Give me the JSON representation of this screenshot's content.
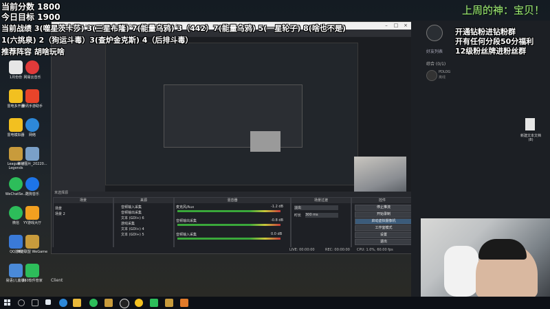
{
  "overlay": {
    "score": "当前分数 1800",
    "goal": "今日目标 1900",
    "record_line1": "当前战绩 3(噬星茨卡莎) 3(三星布隆) 7(能量乌鸦) 3（442）7(能量乌鸦) 5(一星轮子) 8(啥也不是)",
    "record_line2": "1(六挑泉) 2（狗运斗毒）3(查炉金克斯) 4（后排斗毒）",
    "lineup": "推荐阵容 胡啥玩啥",
    "god_text": "上周的神：宝贝！",
    "promo": [
      "开通钻粉进钻粉群",
      "开有任何分段50分福利",
      "12级粉丝牌进粉丝群"
    ]
  },
  "desktop": {
    "icons": [
      {
        "label": "1月份份",
        "color": "#e6e6e6"
      },
      {
        "label": "网易云音乐",
        "color": "#e03a3a"
      },
      {
        "label": "雷电多开器",
        "color": "#f2c020"
      },
      {
        "label": "腾讯手游助手",
        "color": "#e8442a"
      },
      {
        "label": "雷电模拟器",
        "color": "#f2c020"
      },
      {
        "label": "网络",
        "color": "#2d88d8"
      },
      {
        "label": "League of Legends",
        "color": "#c89b3c"
      },
      {
        "label": "微信图片_20220...",
        "color": "#7aa0c8"
      },
      {
        "label": "WeChatSe...",
        "color": "#2dbd5a"
      },
      {
        "label": "酷狗音乐",
        "color": "#1d74e8"
      },
      {
        "label": "微信",
        "color": "#2dbd5a"
      },
      {
        "label": "YY游戏大厅",
        "color": "#f2a020"
      },
      {
        "label": "QQ游戏",
        "color": "#3a7ad8"
      },
      {
        "label": "英雄联盟 WeGame",
        "color": "#c89b3c"
      },
      {
        "label": "易语(儿童版)",
        "color": "#4a8ad8"
      },
      {
        "label": "360软件管家",
        "color": "#2dbd5a"
      }
    ],
    "right_icon_label": "新建文本文档(8)",
    "client_label": "Client"
  },
  "right_panel": {
    "header": "好友列表",
    "group": "综合 (0/1)",
    "user_name": "PDLOG",
    "user_status": "离线"
  },
  "obs": {
    "title": "OBS 27.1.3 (64-bit, windows) - 配置文件: 未命名 - 场景: 未命名",
    "docks": {
      "scenes": {
        "title": "场景",
        "items": [
          "场景",
          "场景 2"
        ]
      },
      "sources": {
        "title": "来源",
        "items": [
          "音频输入采集",
          "音频输出采集",
          "文本 (GDI+) 6",
          "游戏采集",
          "文本 (GDI+) 4",
          "文本 (GDI+) 5"
        ]
      },
      "mixer": {
        "title": "混音器",
        "channels": [
          {
            "name": "音频输出采集",
            "db": "-0.8 dB"
          },
          {
            "name": "麦克风/Aux",
            "db": "-1.2 dB"
          },
          {
            "name": "音频输入采集",
            "db": "0.0 dB"
          }
        ]
      },
      "transitions": {
        "title": "场景过渡",
        "type": "淡出",
        "duration_label": "时长",
        "duration": "300 ms"
      },
      "controls": {
        "title": "控件",
        "buttons": [
          "停止推流",
          "开始录制",
          "启动虚拟摄像机",
          "工作室模式",
          "设置",
          "退出"
        ]
      }
    },
    "source_header": "未选择源",
    "status": {
      "live": "LIVE: 00:00:00",
      "rec": "REC: 00:00:00",
      "cpu": "CPU: 1.0%, 60.00 fps"
    }
  },
  "colors": {
    "god_text": "#a8f07a",
    "obs_bg": "#2a2c31",
    "taskbar": "#0d1016"
  }
}
